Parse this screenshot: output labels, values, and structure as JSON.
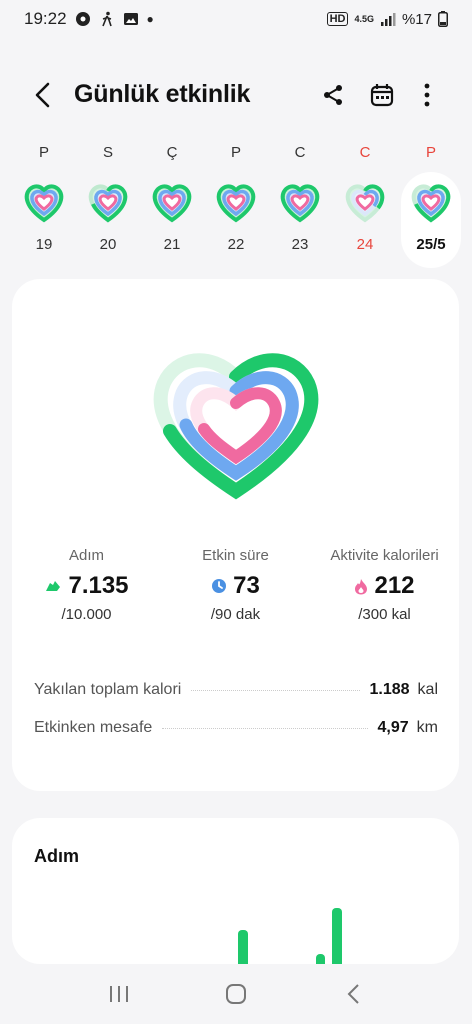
{
  "status": {
    "time": "19:22",
    "network": "4.5G",
    "battery": "%17"
  },
  "header": {
    "title": "Günlük etkinlik"
  },
  "week": [
    {
      "letter": "P",
      "date": "19",
      "weekend": false,
      "selected": false
    },
    {
      "letter": "S",
      "date": "20",
      "weekend": false,
      "selected": false
    },
    {
      "letter": "Ç",
      "date": "21",
      "weekend": false,
      "selected": false
    },
    {
      "letter": "P",
      "date": "22",
      "weekend": false,
      "selected": false
    },
    {
      "letter": "C",
      "date": "23",
      "weekend": false,
      "selected": false
    },
    {
      "letter": "C",
      "date": "24",
      "weekend": true,
      "selected": false
    },
    {
      "letter": "P",
      "date": "25/5",
      "weekend": true,
      "selected": true
    }
  ],
  "stats": {
    "steps": {
      "label": "Adım",
      "value": "7.135",
      "goal": "/10.000"
    },
    "active_time": {
      "label": "Etkin süre",
      "value": "73",
      "goal": "/90 dak"
    },
    "calories": {
      "label": "Aktivite kalorileri",
      "value": "212",
      "goal": "/300 kal"
    }
  },
  "rows": [
    {
      "label": "Yakılan toplam kalori",
      "value": "1.188",
      "unit": "kal"
    },
    {
      "label": "Etkinken mesafe",
      "value": "4,97",
      "unit": "km"
    }
  ],
  "steps_card": {
    "title": "Adım"
  },
  "colors": {
    "green": "#1ec86b",
    "blue": "#6ea8f0",
    "pink": "#f06aa0",
    "weekend_red": "#e8453c"
  }
}
